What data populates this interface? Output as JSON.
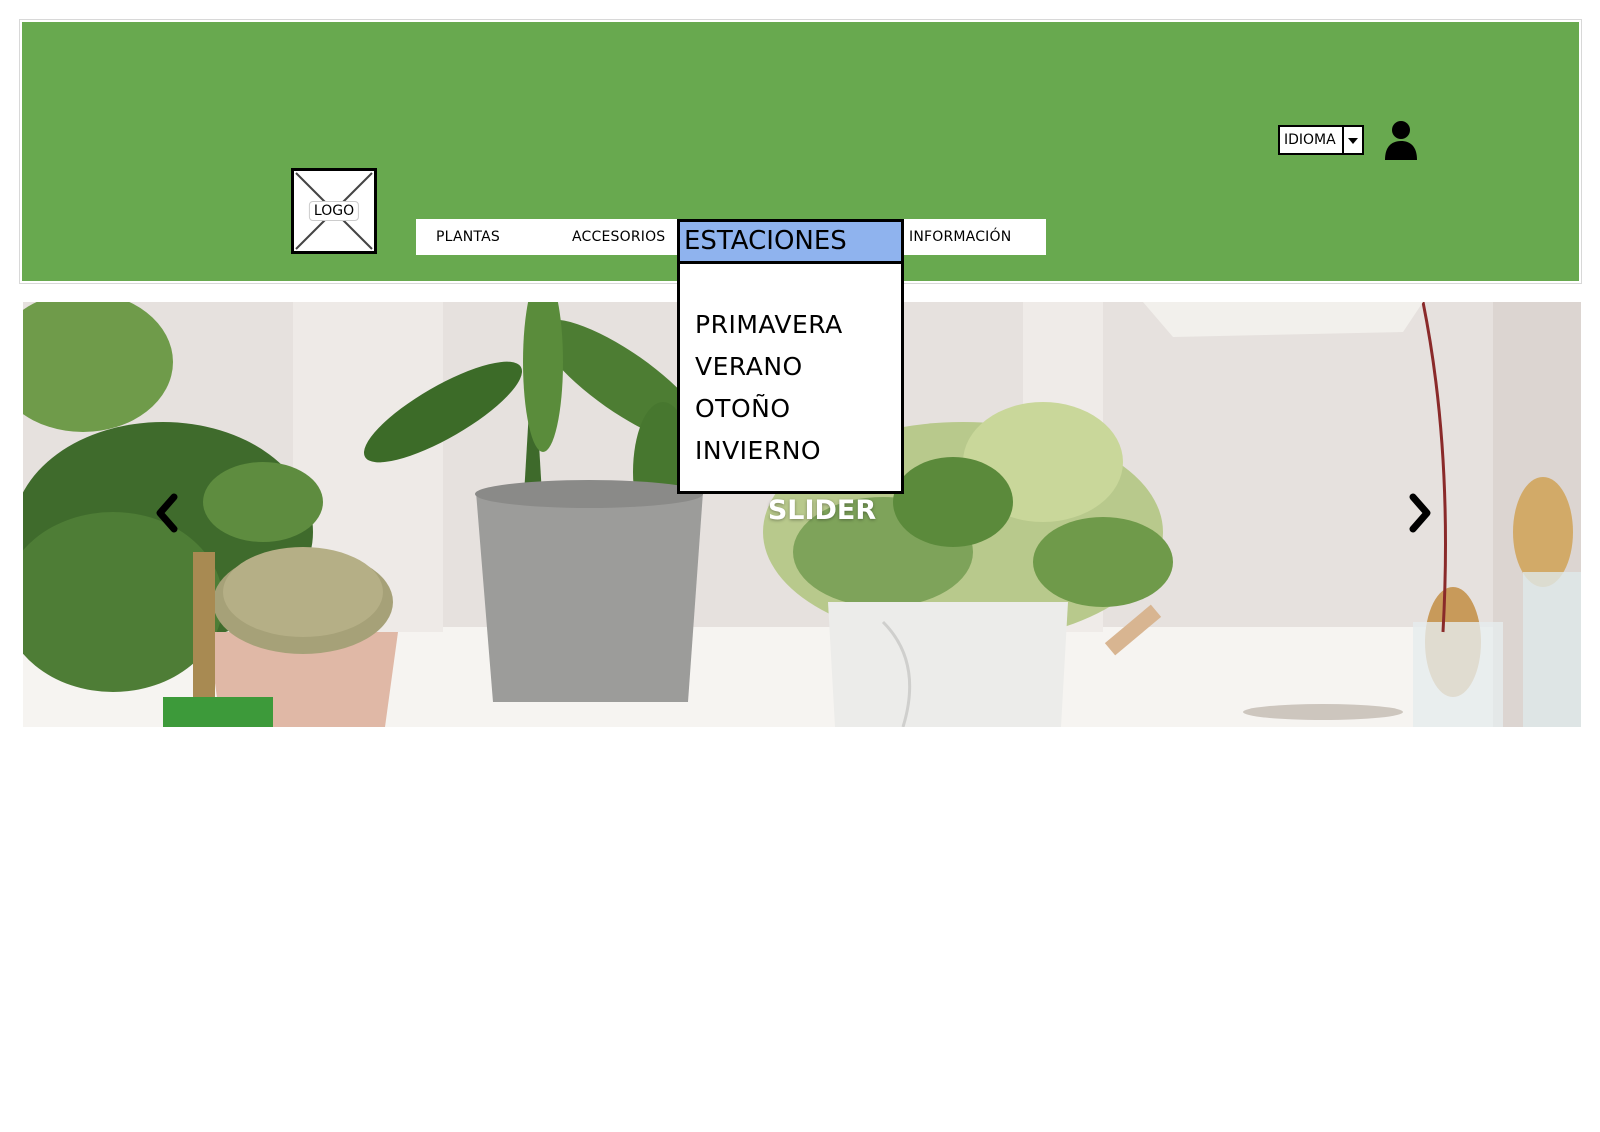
{
  "header": {
    "logo_label": "LOGO",
    "nav": {
      "plantas": "PLANTAS",
      "accesorios": "ACCESORIOS",
      "informacion": "INFORMACIÓN"
    },
    "language_select": {
      "value": "IDIOMA"
    },
    "user_icon": "user-icon"
  },
  "dropdown": {
    "title": "ESTACIONES",
    "items": [
      "PRIMAVERA",
      "VERANO",
      "OTOÑO",
      "INVIERNO"
    ]
  },
  "slider": {
    "label": "SLIDER",
    "prev_icon": "chevron-left-icon",
    "next_icon": "chevron-right-icon"
  },
  "colors": {
    "header_bg": "#68a94f",
    "dropdown_header_bg": "#8fb3ee"
  }
}
